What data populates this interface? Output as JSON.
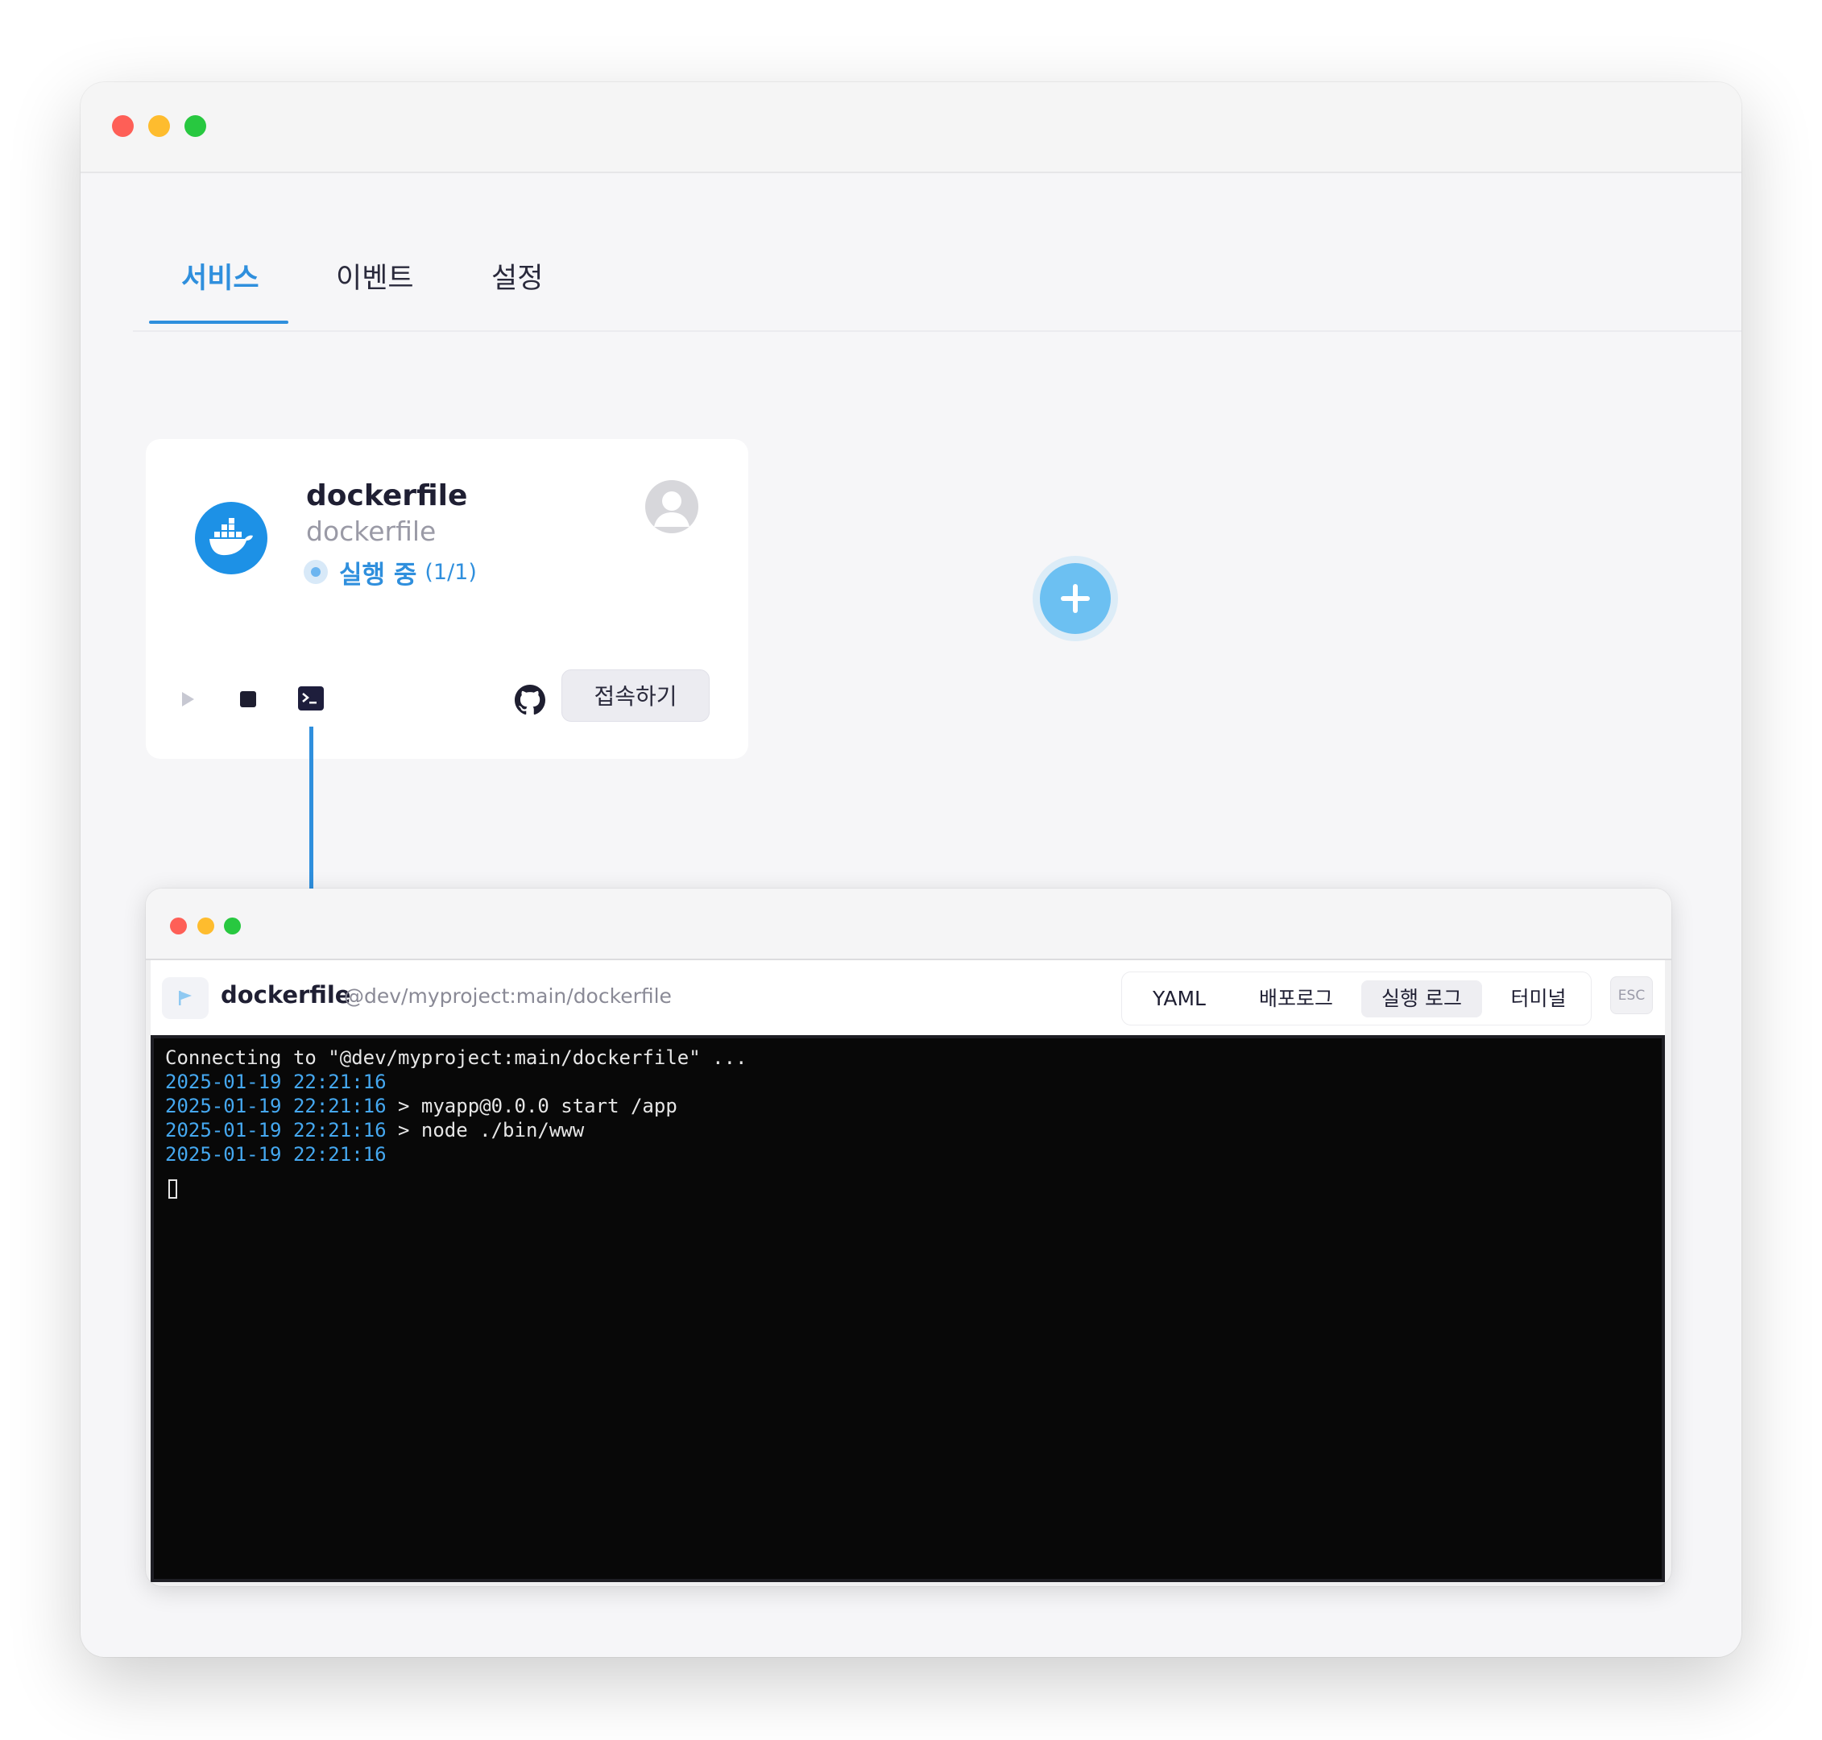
{
  "tabs": [
    {
      "label": "서비스",
      "active": true
    },
    {
      "label": "이벤트",
      "active": false
    },
    {
      "label": "설정",
      "active": false
    }
  ],
  "service_card": {
    "name": "dockerfile",
    "subtitle": "dockerfile",
    "status_label": "실행 중",
    "status_count": "(1/1)",
    "connect_label": "접속하기"
  },
  "panel": {
    "name": "dockerfile",
    "path": "@dev/myproject:main/dockerfile",
    "tabs": [
      {
        "label": "YAML",
        "active": false
      },
      {
        "label": "배포로그",
        "active": false
      },
      {
        "label": "실행 로그",
        "active": true
      },
      {
        "label": "터미널",
        "active": false
      }
    ],
    "esc_label": "ESC"
  },
  "terminal": {
    "lines": [
      {
        "ts": "",
        "text": "Connecting to \"@dev/myproject:main/dockerfile\" ..."
      },
      {
        "ts": "2025-01-19 22:21:16",
        "text": ""
      },
      {
        "ts": "2025-01-19 22:21:16",
        "text": " > myapp@0.0.0 start /app"
      },
      {
        "ts": "2025-01-19 22:21:16",
        "text": " > node ./bin/www"
      },
      {
        "ts": "2025-01-19 22:21:16",
        "text": ""
      }
    ]
  },
  "colors": {
    "accent": "#2f8fdd",
    "docker_blue": "#1d91e6",
    "add_button": "#6cc0f2",
    "terminal_bg": "#080808",
    "timestamp": "#45a8f0"
  }
}
